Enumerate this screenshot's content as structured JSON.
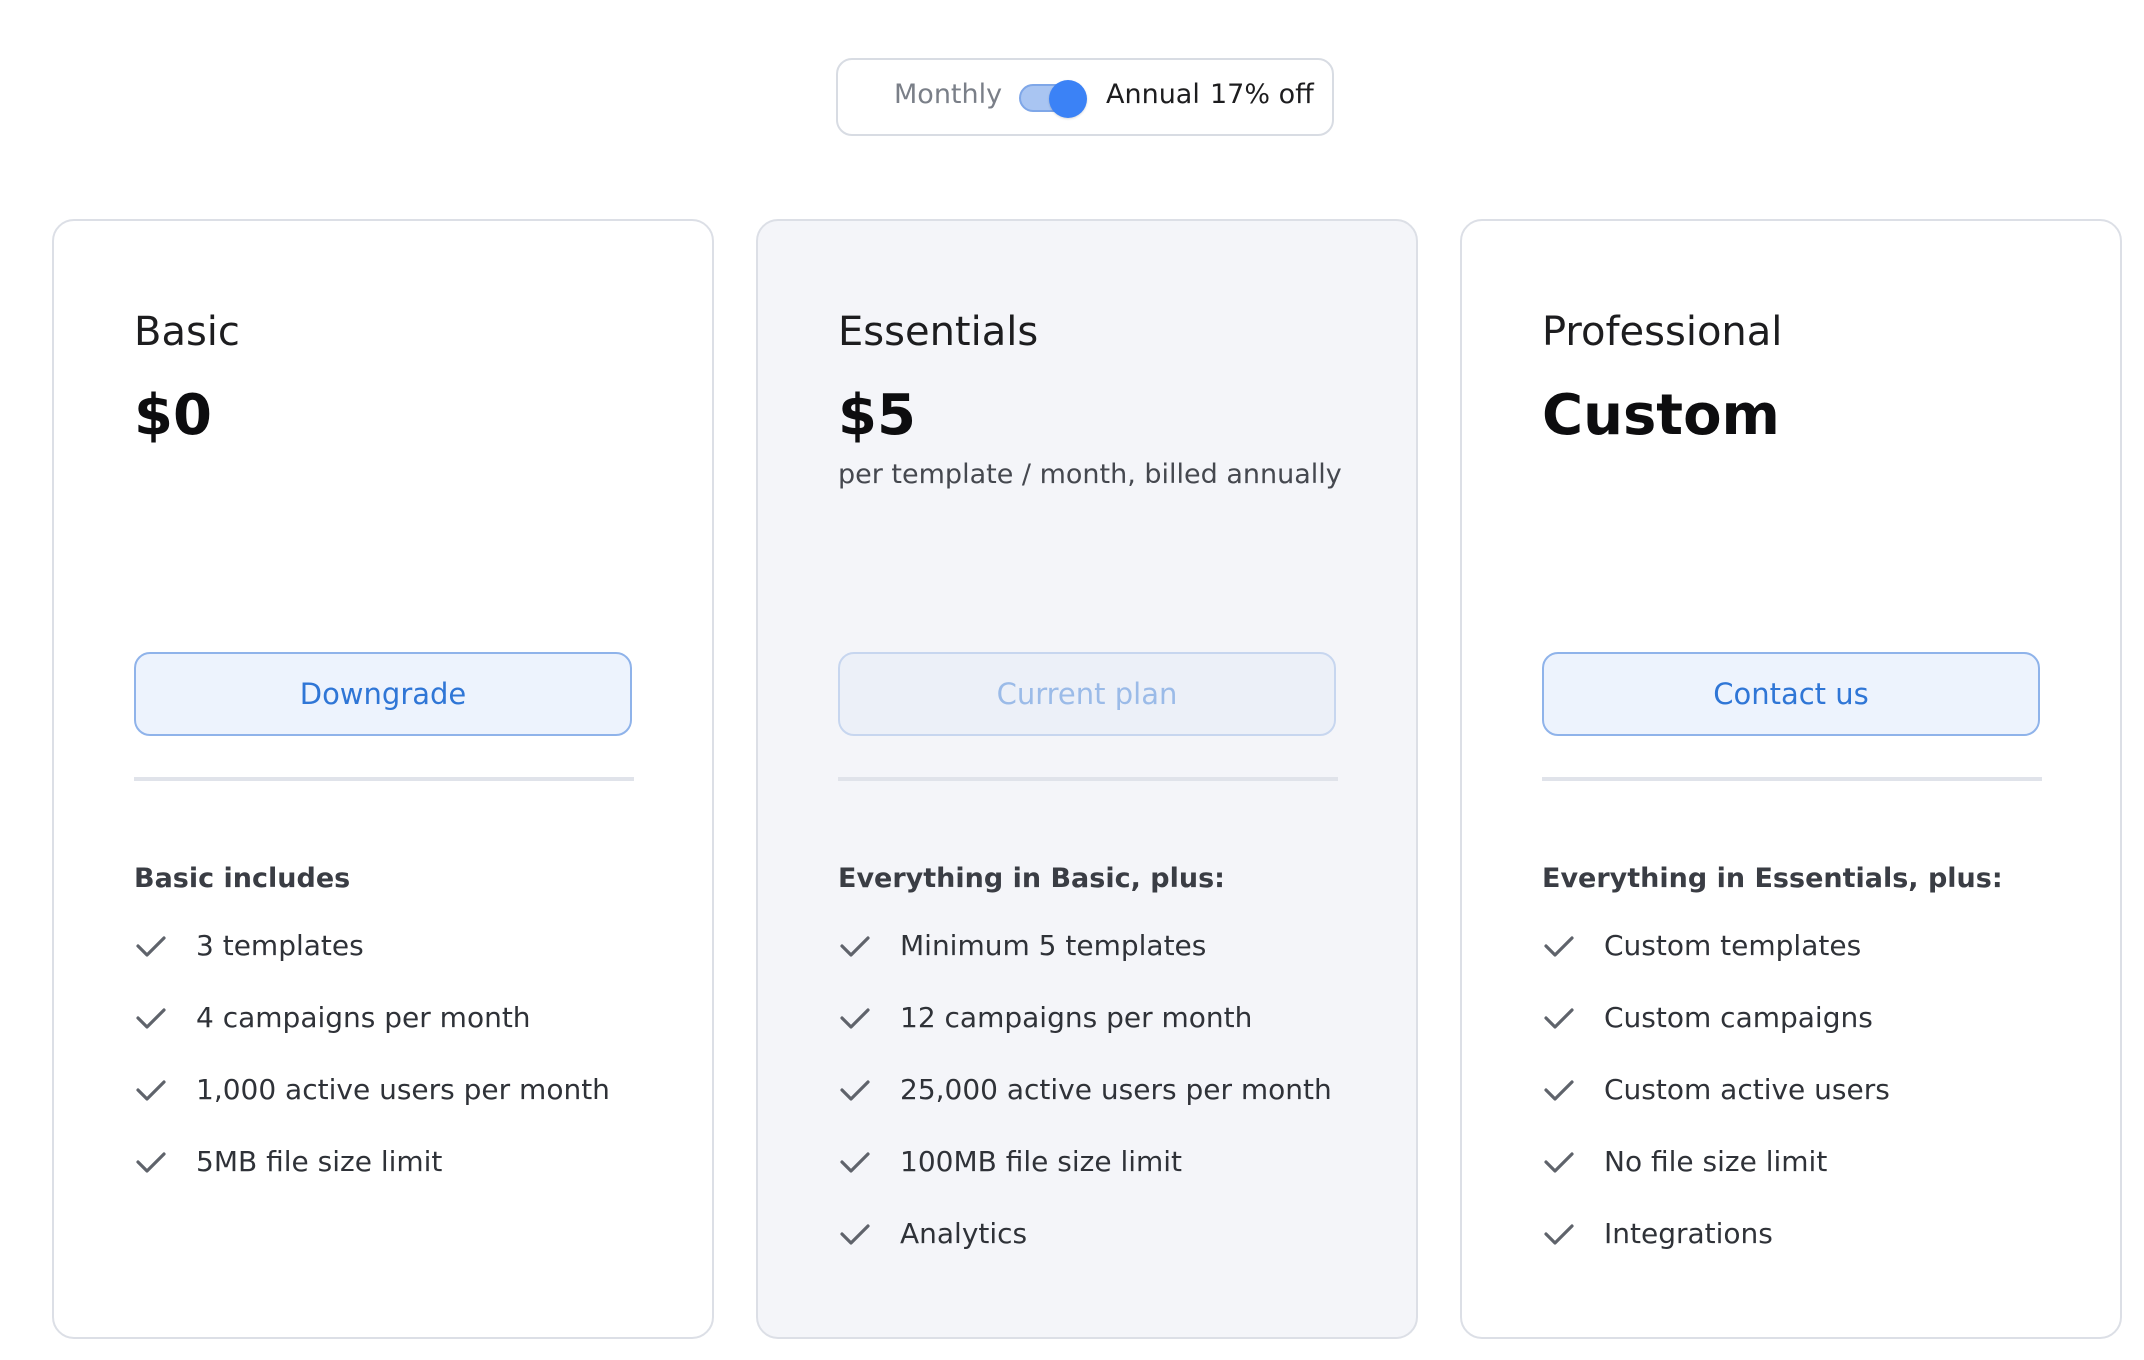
{
  "billing_toggle": {
    "monthly_label": "Monthly",
    "annual_label": "Annual",
    "discount_label": "17% off",
    "selected": "Annual"
  },
  "plans": [
    {
      "name": "Basic",
      "price": "$0",
      "price_note": "",
      "button_label": "Downgrade",
      "button_disabled": false,
      "features_heading": "Basic includes",
      "features": [
        "3 templates",
        "4 campaigns per month",
        "1,000 active users per month",
        "5MB file size limit"
      ]
    },
    {
      "name": "Essentials",
      "price": "$5",
      "price_note": "per template / month, billed annually",
      "button_label": "Current plan",
      "button_disabled": true,
      "features_heading": "Everything in Basic, plus:",
      "features": [
        "Minimum 5 templates",
        "12 campaigns per month",
        "25,000 active users per month",
        "100MB file size limit",
        "Analytics"
      ]
    },
    {
      "name": "Professional",
      "price": "Custom",
      "price_note": "",
      "button_label": "Contact us",
      "button_disabled": false,
      "features_heading": "Everything in Essentials, plus:",
      "features": [
        "Custom templates",
        "Custom campaigns",
        "Custom active users",
        "No file size limit",
        "Integrations"
      ]
    }
  ],
  "colors": {
    "accent": "#3b82f6",
    "button_text": "#2f76d6",
    "highlight_card_bg": "#f4f5f9",
    "check": "#5f636b"
  }
}
